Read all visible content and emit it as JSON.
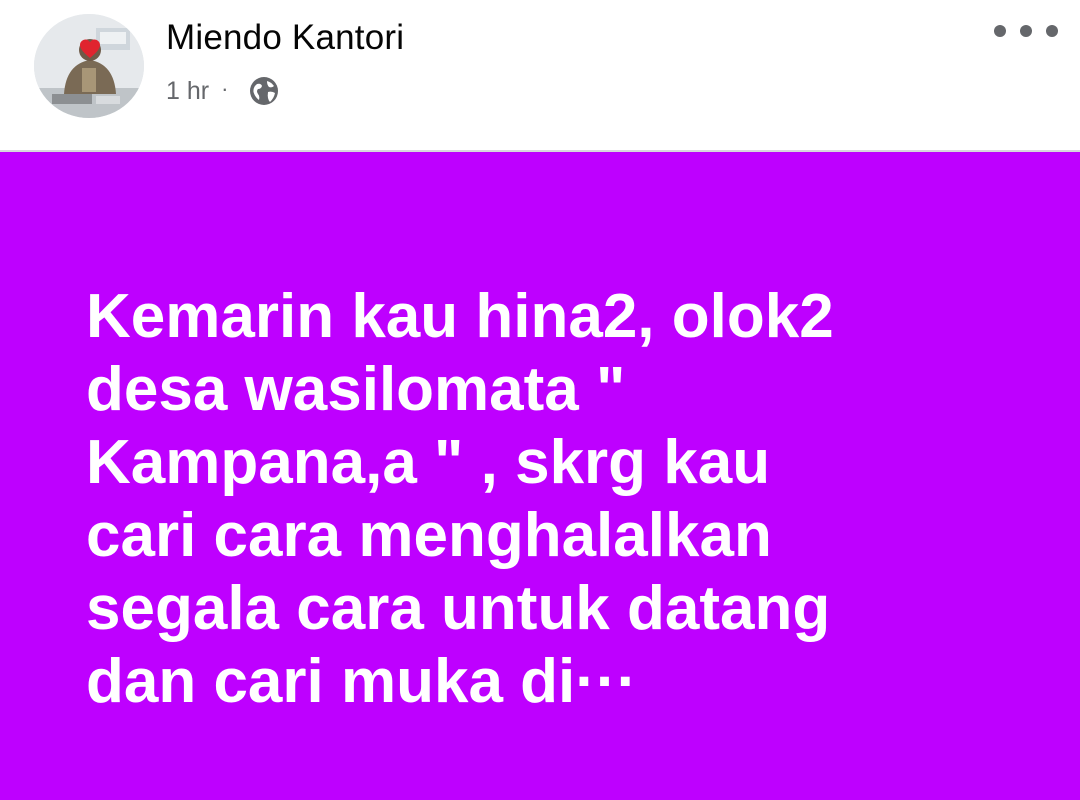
{
  "post": {
    "author_name": "Miendo Kantori",
    "timestamp": "1 hr",
    "separator": "·",
    "privacy_icon": "globe-icon",
    "more_icon": "more-horizontal-icon",
    "avatar": "avatar-photo",
    "body_text": "Kemarin kau hina2, olok2\ndesa wasilomata \"\nKampana,a \" , skrg kau\ncari cara menghalalkan\nsegala cara untuk datang\ndan cari muka di···",
    "background_color": "#be00ff",
    "text_color": "#ffffff"
  }
}
